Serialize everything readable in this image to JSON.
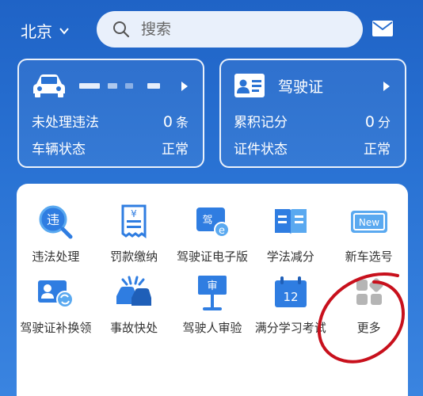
{
  "header": {
    "city": "北京",
    "search_placeholder": "搜索"
  },
  "vehicle_card": {
    "row1_label": "未处理违法",
    "row1_value": "0",
    "row1_unit": "条",
    "row2_label": "车辆状态",
    "row2_value": "正常"
  },
  "license_card": {
    "title": "驾驶证",
    "row1_label": "累积记分",
    "row1_value": "0",
    "row1_unit": "分",
    "row2_label": "证件状态",
    "row2_value": "正常"
  },
  "services": [
    {
      "label": "违法处理",
      "icon": "violation-search-icon"
    },
    {
      "label": "罚款缴纳",
      "icon": "fine-receipt-icon"
    },
    {
      "label": "驾驶证电子版",
      "icon": "e-license-icon"
    },
    {
      "label": "学法减分",
      "icon": "book-icon"
    },
    {
      "label": "新车选号",
      "icon": "new-plate-icon"
    },
    {
      "label": "驾驶证补换领",
      "icon": "license-renew-icon"
    },
    {
      "label": "事故快处",
      "icon": "accident-icon"
    },
    {
      "label": "驾驶人审验",
      "icon": "review-board-icon"
    },
    {
      "label": "满分学习考试",
      "icon": "calendar-12-icon"
    },
    {
      "label": "更多",
      "icon": "more-grid-icon"
    }
  ],
  "icon_text": {
    "violation": "违",
    "fine": "¥",
    "elicense": "驾",
    "newplate": "New",
    "review": "审",
    "calendar": "12"
  },
  "colors": {
    "background": "#2a73d4",
    "icon_blue": "#2f7de1",
    "icon_light": "#5aa9f0",
    "more_gray": "#b5b5b5",
    "annotation_red": "#c8101c"
  }
}
